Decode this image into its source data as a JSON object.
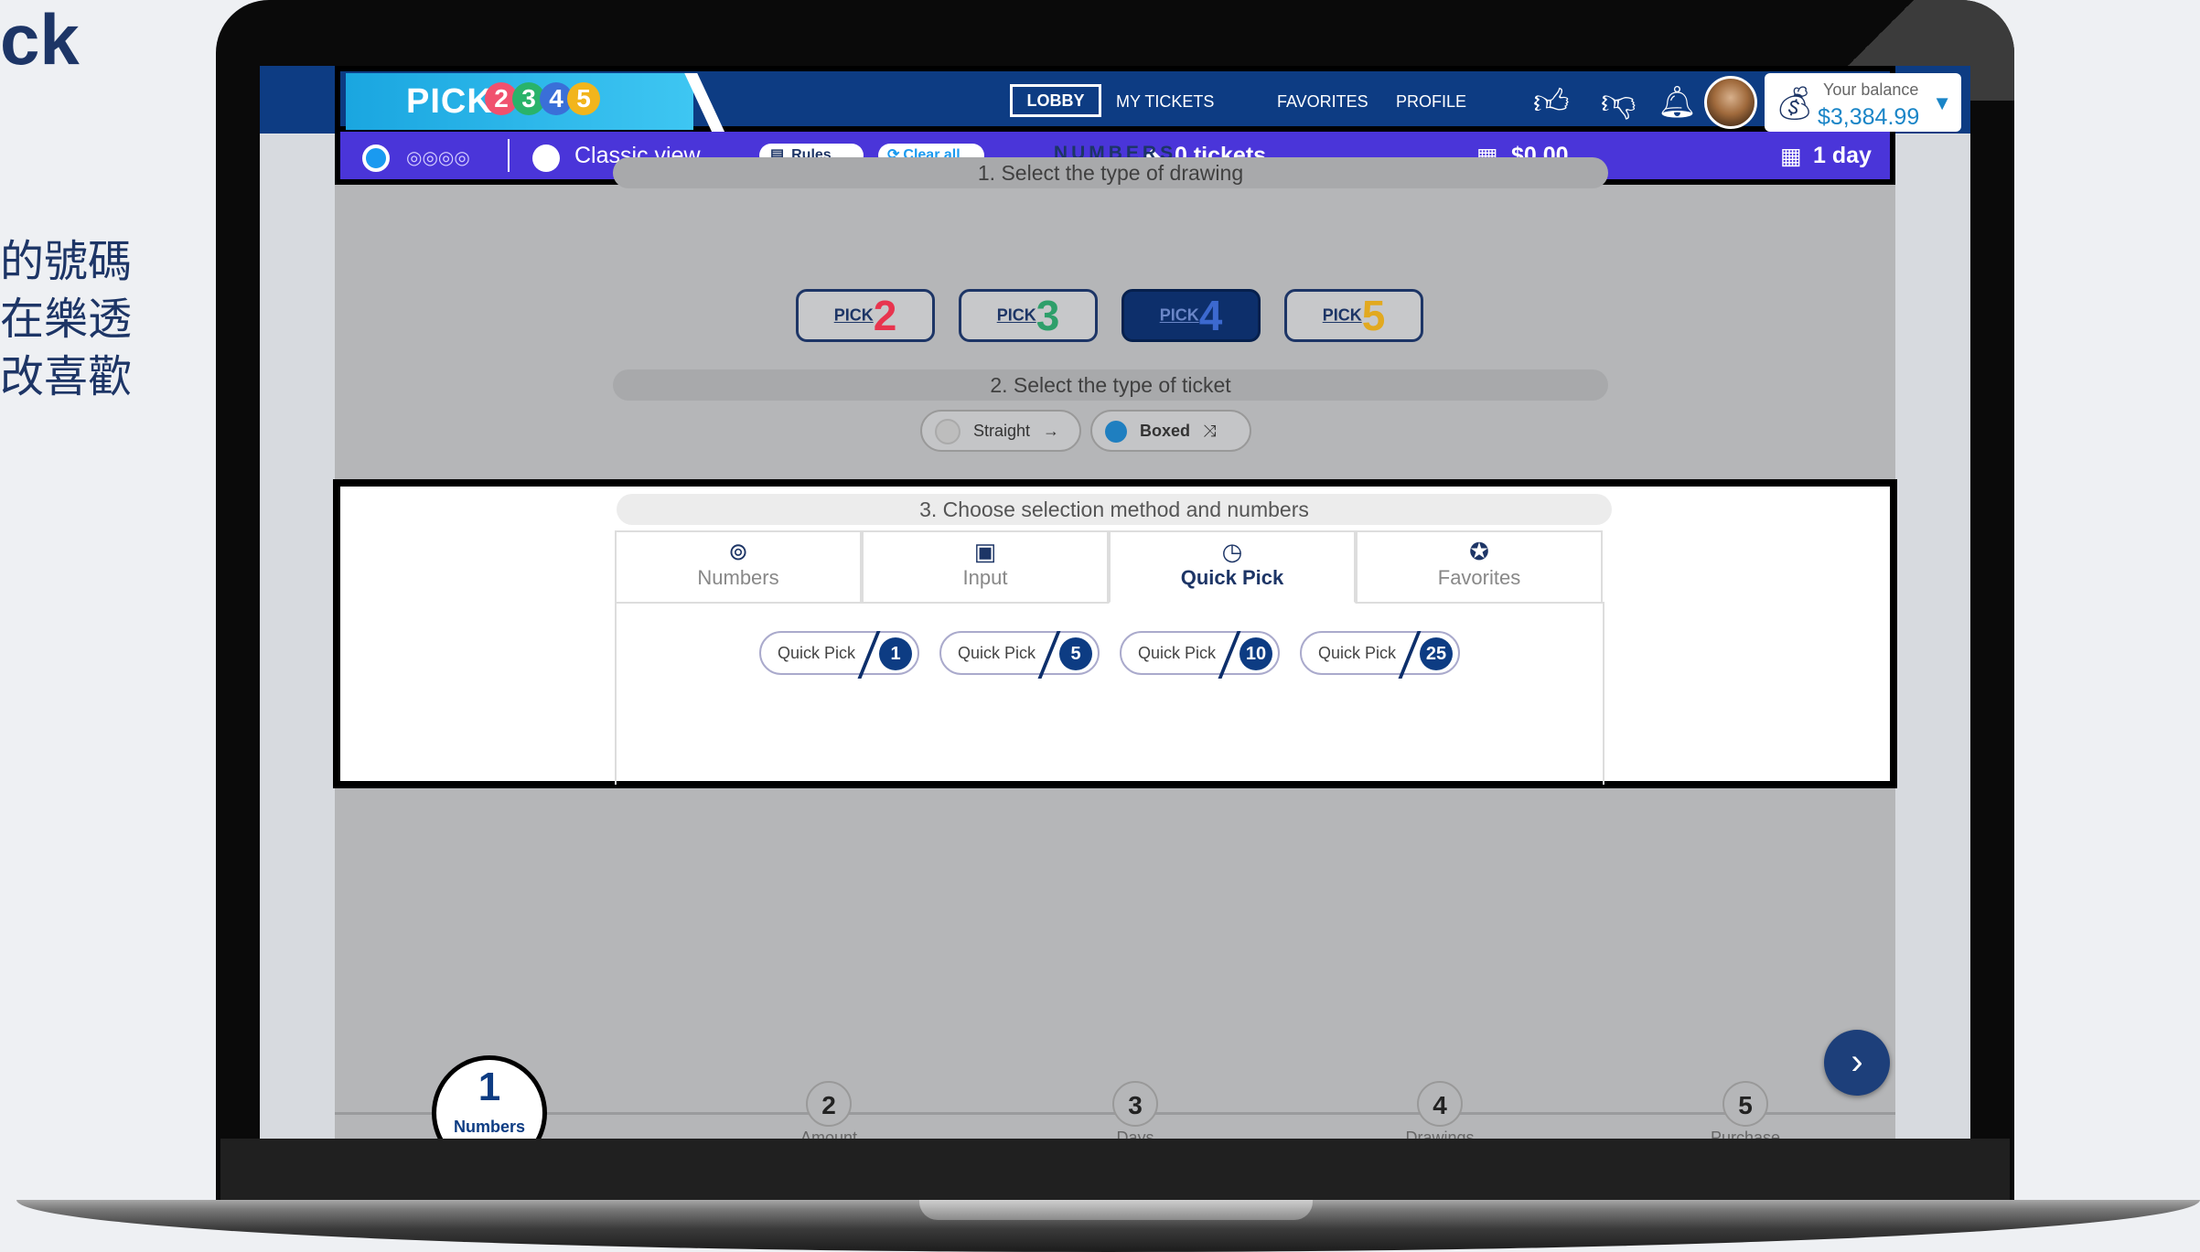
{
  "slide": {
    "title": "ck",
    "lines": "的號碼\n在樂透\n改喜歡"
  },
  "header": {
    "logo_text": "PICK",
    "logo_balls": [
      "2",
      "3",
      "4",
      "5"
    ],
    "nav": {
      "lobby": "LOBBY",
      "my_tickets": "MY TICKETS",
      "favorites": "FAVORITES",
      "profile": "PROFILE"
    },
    "balance_label": "Your balance",
    "balance_amount": "$3,384.99"
  },
  "subheader": {
    "classic_view": "Classic view",
    "rules": "Rules",
    "clear_all": "Clear all",
    "tickets": "0 tickets",
    "total": "$0.00",
    "days": "1 day"
  },
  "main": {
    "title": "NUMBERS",
    "step1": "1. Select the type of drawing",
    "drawing_types": [
      {
        "label": "PICK",
        "digit": "2"
      },
      {
        "label": "PICK",
        "digit": "3"
      },
      {
        "label": "PICK",
        "digit": "4"
      },
      {
        "label": "PICK",
        "digit": "5"
      }
    ],
    "step2": "2. Select the type of ticket",
    "ticket_types": [
      "Straight",
      "Boxed"
    ],
    "step3": "3. Choose selection method and numbers",
    "tabs": [
      "Numbers",
      "Input",
      "Quick Pick",
      "Favorites"
    ],
    "quick_pick_label": "Quick Pick",
    "quick_picks": [
      "1",
      "5",
      "10",
      "25"
    ]
  },
  "progress": {
    "steps": [
      {
        "num": "1",
        "label": "Numbers"
      },
      {
        "num": "2",
        "label": "Amount"
      },
      {
        "num": "3",
        "label": "Days"
      },
      {
        "num": "4",
        "label": "Drawings"
      },
      {
        "num": "5",
        "label": "Purchase"
      }
    ]
  },
  "colors": {
    "header_blue": "#0d3c83",
    "subheader_purple": "#4a35d9",
    "accent_cyan": "#1aa6e0"
  }
}
